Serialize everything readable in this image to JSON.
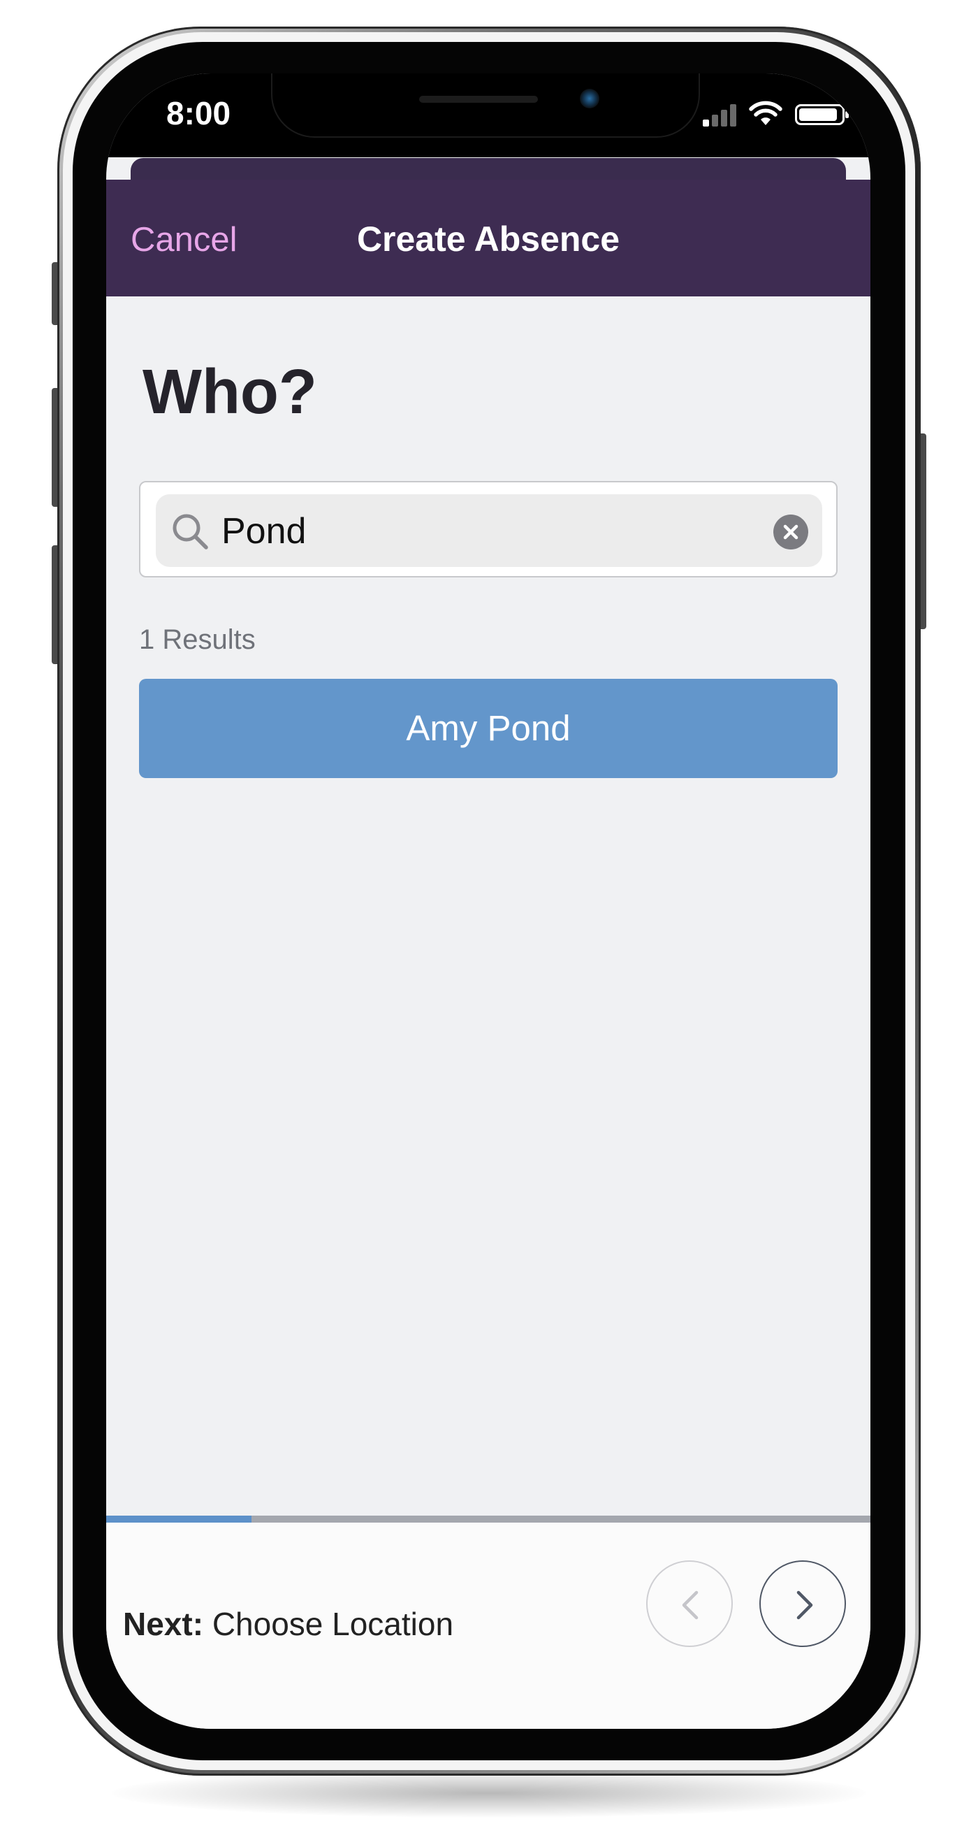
{
  "status_bar": {
    "time": "8:00"
  },
  "header": {
    "cancel_label": "Cancel",
    "title": "Create Absence"
  },
  "main": {
    "heading": "Who?",
    "search": {
      "value": "Pond",
      "placeholder": ""
    },
    "results_count": "1 Results",
    "results": [
      {
        "name": "Amy Pond"
      }
    ]
  },
  "footer": {
    "next_prefix": "Next:",
    "next_step": "Choose Location",
    "progress_fraction": 0.19
  },
  "colors": {
    "header_bg": "#3e2c52",
    "cancel_text": "#e7a6e8",
    "result_bg": "#6396cb",
    "progress_fill": "#5d91c9",
    "page_bg": "#f0f1f3"
  },
  "icons": [
    "search-icon",
    "clear-icon",
    "chevron-left-icon",
    "chevron-right-icon",
    "signal-icon",
    "wifi-icon",
    "battery-icon"
  ]
}
